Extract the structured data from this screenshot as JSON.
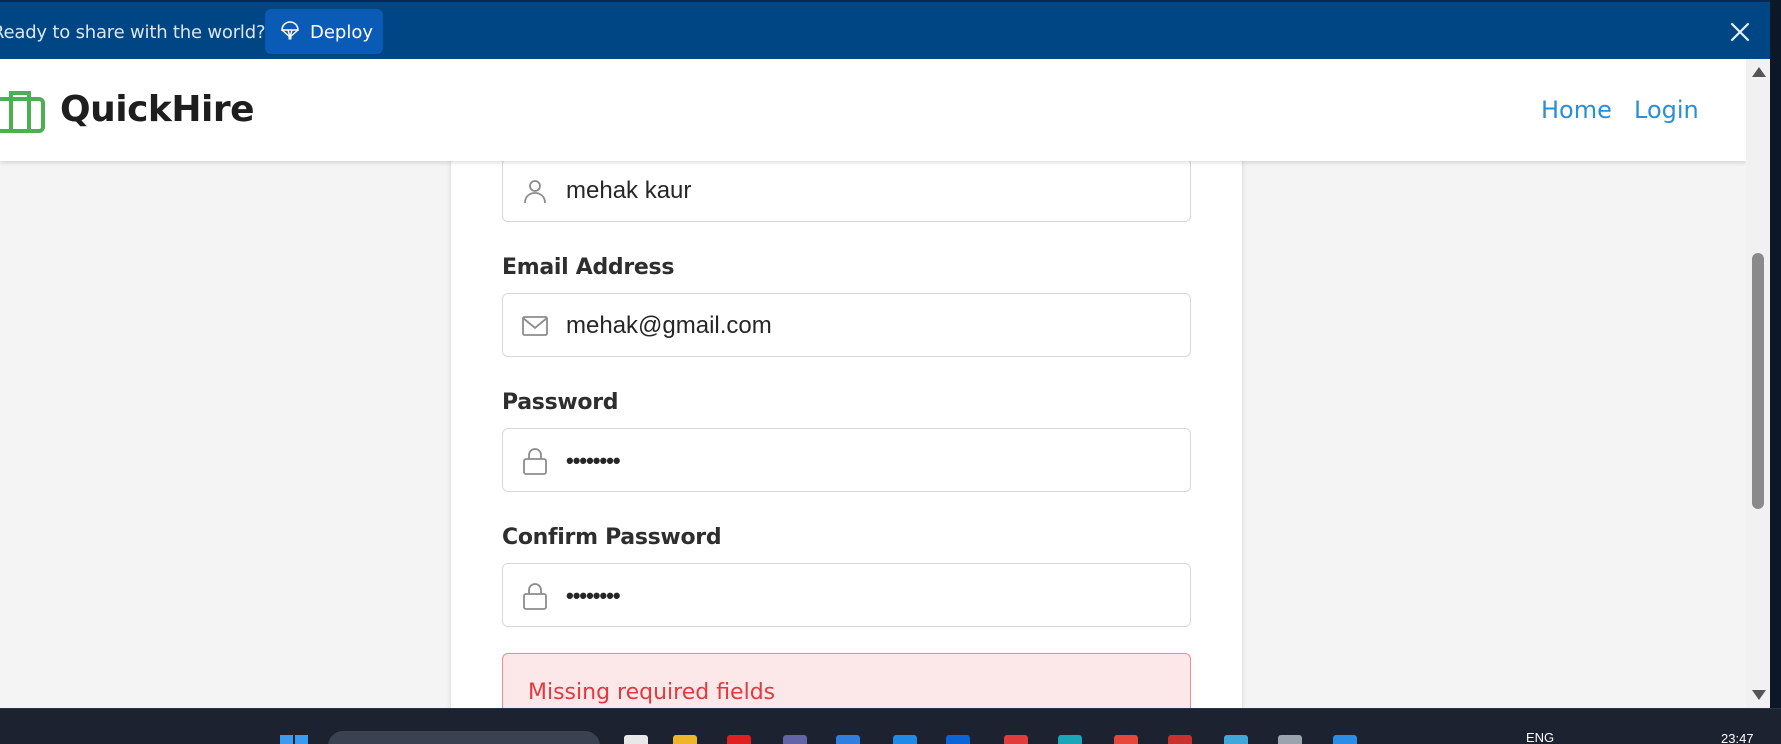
{
  "banner": {
    "text": "Ready to share with the world?",
    "deploy_label": "Deploy"
  },
  "navbar": {
    "brand": "QuickHire",
    "links": [
      "Home",
      "Login"
    ]
  },
  "form": {
    "name_value": "mehak kaur",
    "email_label": "Email Address",
    "email_value": "mehak@gmail.com",
    "password_label": "Password",
    "password_value": "••••••••",
    "confirm_label": "Confirm Password",
    "confirm_value": "••••••••",
    "error": "Missing required fields"
  },
  "taskbar": {
    "lang": "ENG",
    "time": "23:47"
  },
  "colors": {
    "banner_bg": "#004584",
    "brand_green": "#4caf50",
    "link_blue": "#2a8fd6",
    "error_red": "#e3393f"
  }
}
